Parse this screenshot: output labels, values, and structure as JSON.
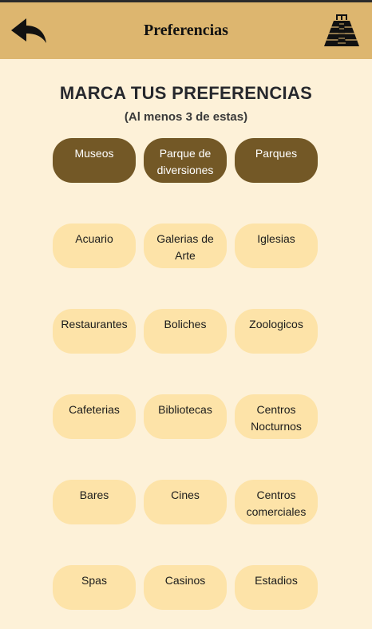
{
  "header": {
    "title": "Preferencias",
    "back_icon": "back-arrow-icon",
    "logo_icon": "pyramid-icon"
  },
  "main": {
    "heading": "MARCA TUS PREFERENCIAS",
    "subheading": "(Al menos 3 de estas)"
  },
  "colors": {
    "appbar": "#ddb66f",
    "background": "#fdf1d8",
    "option_selected": "#735826",
    "option_unselected": "#fde3a8"
  },
  "options": [
    {
      "label": "Museos",
      "selected": true
    },
    {
      "label": "Parque de diversiones",
      "selected": true
    },
    {
      "label": "Parques",
      "selected": true
    },
    {
      "label": "Acuario",
      "selected": false
    },
    {
      "label": "Galerias de Arte",
      "selected": false
    },
    {
      "label": "Iglesias",
      "selected": false
    },
    {
      "label": "Restaurantes",
      "selected": false
    },
    {
      "label": "Boliches",
      "selected": false
    },
    {
      "label": "Zoologicos",
      "selected": false
    },
    {
      "label": "Cafeterias",
      "selected": false
    },
    {
      "label": "Bibliotecas",
      "selected": false
    },
    {
      "label": "Centros Nocturnos",
      "selected": false
    },
    {
      "label": "Bares",
      "selected": false
    },
    {
      "label": "Cines",
      "selected": false
    },
    {
      "label": "Centros comerciales",
      "selected": false
    },
    {
      "label": "Spas",
      "selected": false
    },
    {
      "label": "Casinos",
      "selected": false
    },
    {
      "label": "Estadios",
      "selected": false
    }
  ]
}
